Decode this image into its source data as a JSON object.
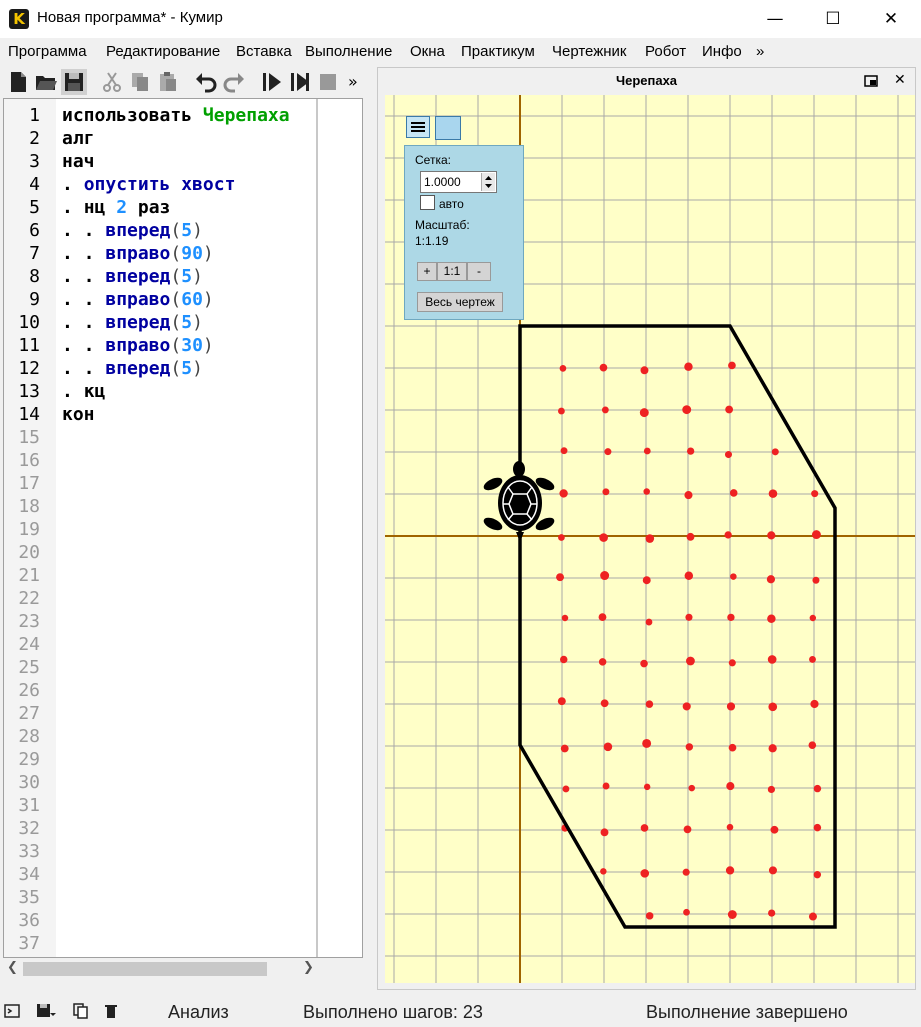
{
  "window": {
    "title": "Новая программа* - Кумир",
    "app_icon_letter": "K",
    "minimize": "—",
    "maximize": "☐",
    "close": "✕"
  },
  "menu": [
    "Программа",
    "Редактирование",
    "Вставка",
    "Выполнение",
    "Окна",
    "Практикум",
    "Чертежник",
    "Робот",
    "Инфо",
    "»"
  ],
  "toolbar_overflow": "»",
  "editor": {
    "lines": [
      [
        {
          "t": "использовать ",
          "c": "kw"
        },
        {
          "t": "Черепаха",
          "c": "mod"
        }
      ],
      [
        {
          "t": "алг",
          "c": "kw"
        }
      ],
      [
        {
          "t": "нач",
          "c": "kw"
        }
      ],
      [
        {
          "t": ". ",
          "c": "dot"
        },
        {
          "t": "опустить хвост",
          "c": "cmd"
        }
      ],
      [
        {
          "t": ". ",
          "c": "dot"
        },
        {
          "t": "нц ",
          "c": "kw"
        },
        {
          "t": "2",
          "c": "num"
        },
        {
          "t": " раз",
          "c": "kw"
        }
      ],
      [
        {
          "t": ". . ",
          "c": "dot"
        },
        {
          "t": "вперед",
          "c": "cmd"
        },
        {
          "t": "(",
          "c": "par"
        },
        {
          "t": "5",
          "c": "num"
        },
        {
          "t": ")",
          "c": "par"
        }
      ],
      [
        {
          "t": ". . ",
          "c": "dot"
        },
        {
          "t": "вправо",
          "c": "cmd"
        },
        {
          "t": "(",
          "c": "par"
        },
        {
          "t": "90",
          "c": "num"
        },
        {
          "t": ")",
          "c": "par"
        }
      ],
      [
        {
          "t": ". . ",
          "c": "dot"
        },
        {
          "t": "вперед",
          "c": "cmd"
        },
        {
          "t": "(",
          "c": "par"
        },
        {
          "t": "5",
          "c": "num"
        },
        {
          "t": ")",
          "c": "par"
        }
      ],
      [
        {
          "t": ". . ",
          "c": "dot"
        },
        {
          "t": "вправо",
          "c": "cmd"
        },
        {
          "t": "(",
          "c": "par"
        },
        {
          "t": "60",
          "c": "num"
        },
        {
          "t": ")",
          "c": "par"
        }
      ],
      [
        {
          "t": ". . ",
          "c": "dot"
        },
        {
          "t": "вперед",
          "c": "cmd"
        },
        {
          "t": "(",
          "c": "par"
        },
        {
          "t": "5",
          "c": "num"
        },
        {
          "t": ")",
          "c": "par"
        }
      ],
      [
        {
          "t": ". . ",
          "c": "dot"
        },
        {
          "t": "вправо",
          "c": "cmd"
        },
        {
          "t": "(",
          "c": "par"
        },
        {
          "t": "30",
          "c": "num"
        },
        {
          "t": ")",
          "c": "par"
        }
      ],
      [
        {
          "t": ". . ",
          "c": "dot"
        },
        {
          "t": "вперед",
          "c": "cmd"
        },
        {
          "t": "(",
          "c": "par"
        },
        {
          "t": "5",
          "c": "num"
        },
        {
          "t": ")",
          "c": "par"
        }
      ],
      [
        {
          "t": ". ",
          "c": "dot"
        },
        {
          "t": "кц",
          "c": "kw"
        }
      ],
      [
        {
          "t": "кон",
          "c": "kw"
        }
      ]
    ],
    "line_count": 37,
    "colors": {
      "kw": "#000000",
      "mod": "#00a000",
      "cmd": "#0000a0",
      "num": "#1e90ff",
      "par": "#444444",
      "dot": "#000000"
    }
  },
  "turtle": {
    "title": "Черепаха",
    "grid_label": "Сетка:",
    "grid_value": "1.0000",
    "auto_label": "авто",
    "scale_label": "Масштаб:",
    "scale_value": "1:1.19",
    "zoom_in": "+",
    "zoom_reset": "1:1",
    "zoom_out": "-",
    "whole_drawing": "Весь чертеж"
  },
  "status": {
    "analysis": "Анализ",
    "steps": "Выполнено шагов: 23",
    "state": "Выполнение завершено"
  },
  "colors": {
    "canvas_bg": "#ffffc8",
    "grid": "#a8a8a8",
    "axis": "#a06400",
    "path": "#000000",
    "dots": "#ee2222"
  }
}
